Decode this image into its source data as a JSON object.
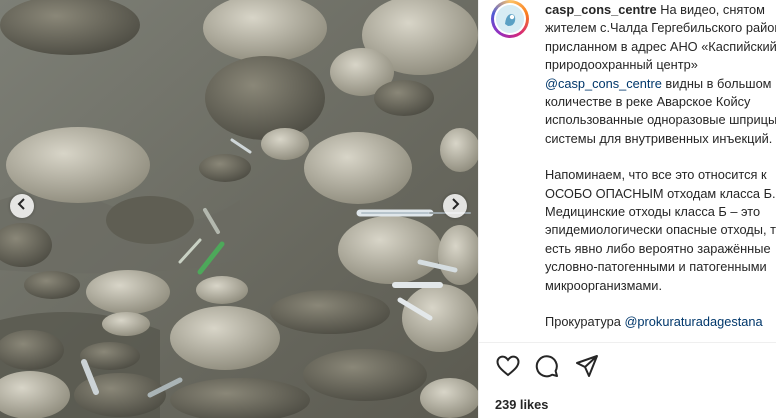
{
  "media": {
    "prev_icon": "chevron-left-icon",
    "next_icon": "chevron-right-icon"
  },
  "post": {
    "username": "casp_cons_centre",
    "caption_p1_a": "На видео, снятом жителем с.Чалда Гергебильского района и присланном в адрес АНО «Каспийский природоохранный центр» ",
    "caption_p1_mention": "@casp_cons_centre",
    "caption_p1_b": " видны в большом количестве в реке Аварское Койсу использованные одноразовые шприцы и системы для внутривенных инъекций.",
    "caption_p2": "Напоминаем, что все это относится к ОСОБО ОПАСНЫМ отходам класса Б. Медицинские отходы класса Б – это эпидемиологически опасные отходы, то есть явно либо вероятно заражённые условно-патогенными и патогенными микроорганизмами.",
    "caption_p3_a": "Прокуратура ",
    "caption_p3_mention": "@prokuraturadagestana"
  },
  "actions": {
    "like_icon": "heart-icon",
    "comment_icon": "comment-icon",
    "share_icon": "paper-plane-icon"
  },
  "likes": {
    "text": "239 likes"
  },
  "colors": {
    "text": "#262626",
    "mention": "#00376b",
    "divider": "#efefef"
  }
}
